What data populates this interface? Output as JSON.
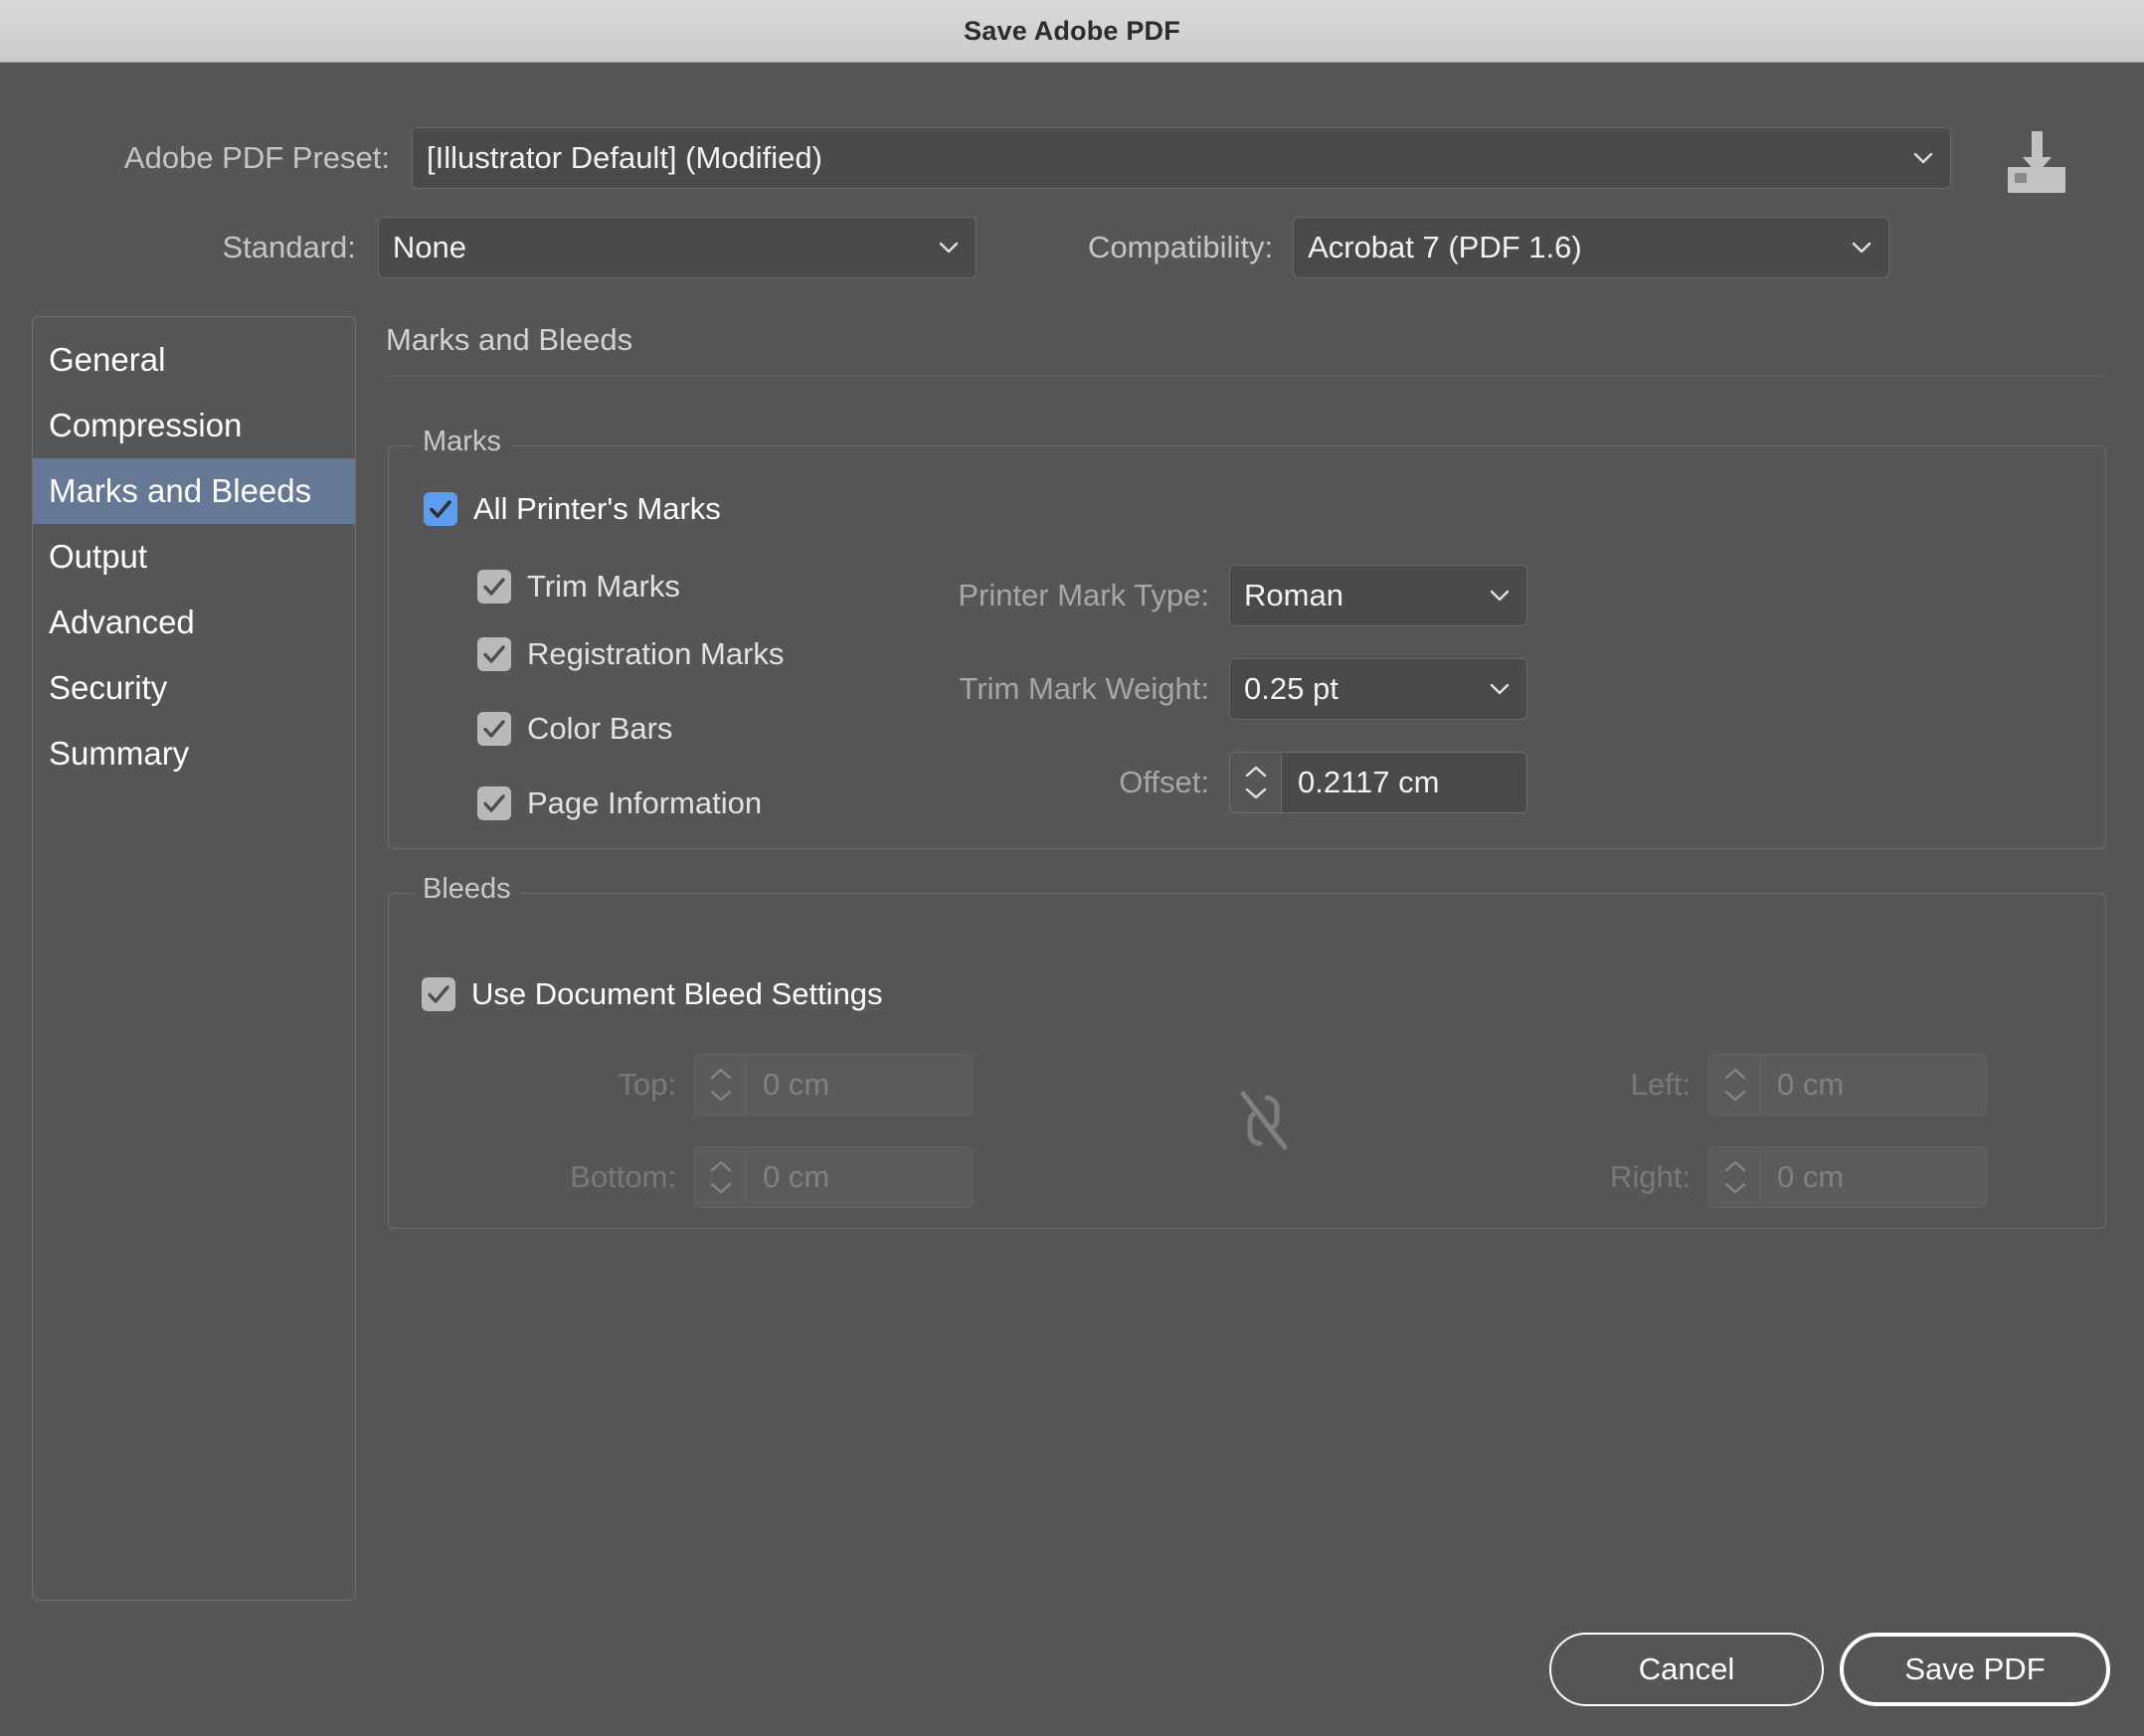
{
  "window": {
    "title": "Save Adobe PDF"
  },
  "header": {
    "preset_label": "Adobe PDF Preset:",
    "preset_value": "[Illustrator Default] (Modified)",
    "standard_label": "Standard:",
    "standard_value": "None",
    "compatibility_label": "Compatibility:",
    "compatibility_value": "Acrobat 7 (PDF 1.6)",
    "save_preset_icon": "save-preset-icon"
  },
  "sidebar": {
    "items": [
      {
        "label": "General",
        "selected": false
      },
      {
        "label": "Compression",
        "selected": false
      },
      {
        "label": "Marks and Bleeds",
        "selected": true
      },
      {
        "label": "Output",
        "selected": false
      },
      {
        "label": "Advanced",
        "selected": false
      },
      {
        "label": "Security",
        "selected": false
      },
      {
        "label": "Summary",
        "selected": false
      }
    ]
  },
  "panel": {
    "title": "Marks and Bleeds",
    "marks": {
      "legend": "Marks",
      "all_printers_marks": {
        "label": "All Printer's Marks",
        "checked": true,
        "state": "enabled"
      },
      "sub_checkboxes": [
        {
          "label": "Trim Marks",
          "checked": true,
          "state": "disabled"
        },
        {
          "label": "Registration Marks",
          "checked": true,
          "state": "disabled"
        },
        {
          "label": "Color Bars",
          "checked": true,
          "state": "disabled"
        },
        {
          "label": "Page Information",
          "checked": true,
          "state": "disabled"
        }
      ],
      "printer_mark_type": {
        "label": "Printer Mark Type:",
        "value": "Roman"
      },
      "trim_mark_weight": {
        "label": "Trim Mark Weight:",
        "value": "0.25 pt"
      },
      "offset": {
        "label": "Offset:",
        "value": "0.2117 cm"
      }
    },
    "bleeds": {
      "legend": "Bleeds",
      "use_document_bleed_settings": {
        "label": "Use Document Bleed Settings",
        "checked": true,
        "state": "enabled"
      },
      "link_icon": "broken-link-icon",
      "fields": {
        "top": {
          "label": "Top:",
          "value": "0 cm",
          "state": "disabled"
        },
        "bottom": {
          "label": "Bottom:",
          "value": "0 cm",
          "state": "disabled"
        },
        "left": {
          "label": "Left:",
          "value": "0 cm",
          "state": "disabled"
        },
        "right": {
          "label": "Right:",
          "value": "0 cm",
          "state": "disabled"
        }
      }
    }
  },
  "footer": {
    "cancel_label": "Cancel",
    "save_label": "Save PDF"
  },
  "colors": {
    "dialog_bg": "#565656",
    "titlebar_bg": "#d2d2d2",
    "selection_blue": "#657896",
    "checkbox_blue": "#5c9ded",
    "checkbox_gray": "#b9b9b9",
    "field_bg": "#4a4a4a"
  }
}
